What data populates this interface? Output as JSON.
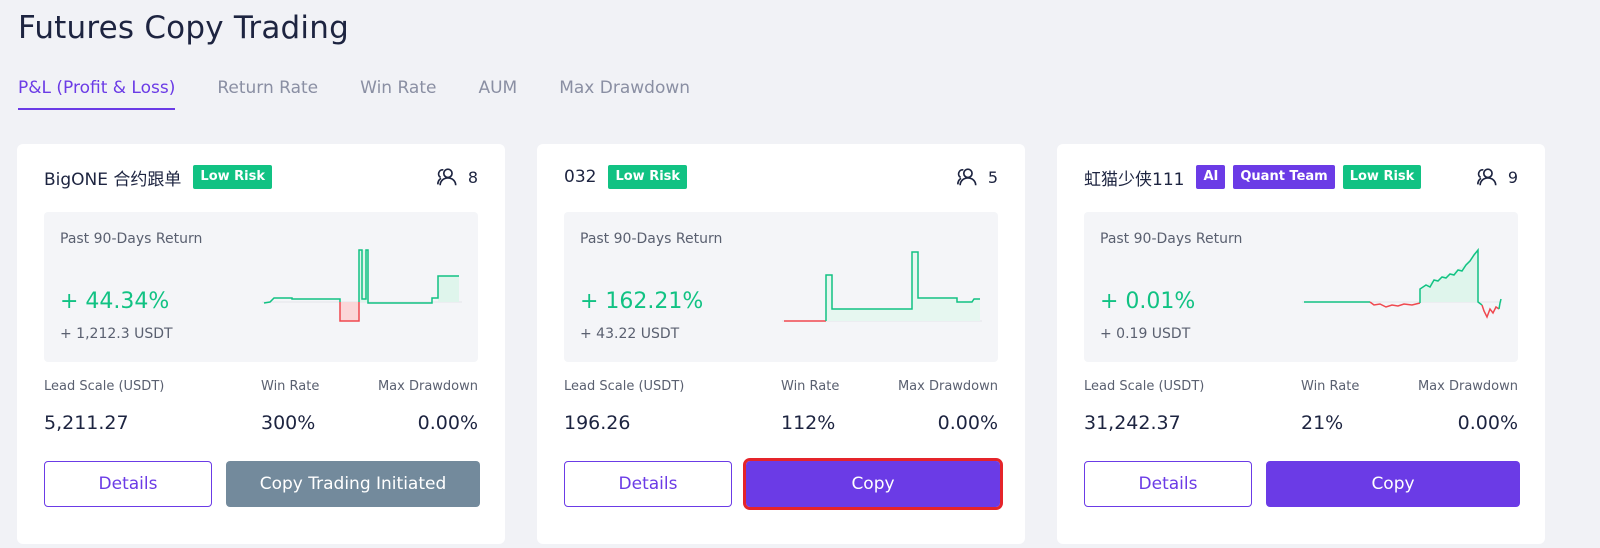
{
  "page": {
    "title": "Futures Copy Trading"
  },
  "tabs": [
    {
      "label": "P&L (Profit & Loss)",
      "active": true
    },
    {
      "label": "Return Rate",
      "active": false
    },
    {
      "label": "Win Rate",
      "active": false
    },
    {
      "label": "AUM",
      "active": false
    },
    {
      "label": "Max Drawdown",
      "active": false
    }
  ],
  "labels": {
    "return_label": "Past 90-Days Return",
    "lead_scale": "Lead Scale (USDT)",
    "win_rate": "Win Rate",
    "max_drawdown": "Max Drawdown",
    "details": "Details"
  },
  "colors": {
    "accent": "#6b3be6",
    "positive": "#11c283",
    "negative": "#f0484f",
    "disabled": "#738a9c",
    "highlight": "#e5242a"
  },
  "cards": [
    {
      "name": "BigONE 合约跟单",
      "badges": [
        {
          "text": "Low Risk",
          "color": "green"
        }
      ],
      "followers": "8",
      "return_pct": "+ 44.34%",
      "return_usdt": "+ 1,212.3 USDT",
      "lead_scale": "5,211.27",
      "win_rate": "300%",
      "max_drawdown": "0.00%",
      "action_label": "Copy Trading Initiated",
      "action_state": "initiated"
    },
    {
      "name": "032",
      "badges": [
        {
          "text": "Low Risk",
          "color": "green"
        }
      ],
      "followers": "5",
      "return_pct": "+ 162.21%",
      "return_usdt": "+ 43.22 USDT",
      "lead_scale": "196.26",
      "win_rate": "112%",
      "max_drawdown": "0.00%",
      "action_label": "Copy",
      "action_state": "highlighted"
    },
    {
      "name": "虹猫少侠111",
      "badges": [
        {
          "text": "AI",
          "color": "purple"
        },
        {
          "text": "Quant Team",
          "color": "purple"
        },
        {
          "text": "Low Risk",
          "color": "green"
        }
      ],
      "followers": "9",
      "return_pct": "+ 0.01%",
      "return_usdt": "+ 0.19 USDT",
      "lead_scale": "31,242.37",
      "win_rate": "21%",
      "max_drawdown": "0.00%",
      "action_label": "Copy",
      "action_state": "normal"
    }
  ]
}
